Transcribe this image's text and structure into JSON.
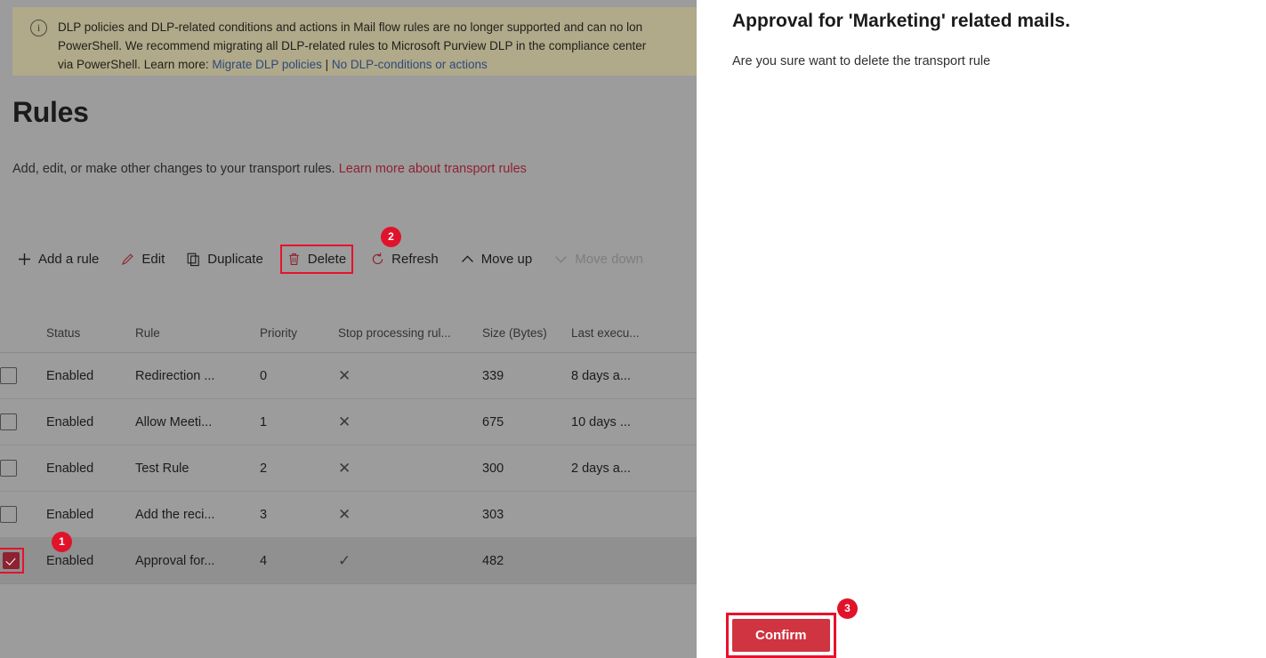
{
  "banner": {
    "icon": "info-icon",
    "line1": "DLP policies and DLP-related conditions and actions in Mail flow rules are no longer supported and can no lon",
    "line2": "PowerShell. We recommend migrating all DLP-related rules to Microsoft Purview DLP in the compliance center",
    "line3_prefix": "via PowerShell. Learn more: ",
    "link1": "Migrate DLP policies",
    "separator": " | ",
    "link2": "No DLP-conditions or actions",
    "background": "#b0a98a"
  },
  "page": {
    "title": "Rules",
    "subtitle_text": "Add, edit, or make other changes to your transport rules. ",
    "subtitle_link": "Learn more about transport rules"
  },
  "command_bar": {
    "items": [
      {
        "label": "Add a rule",
        "icon": "plus-icon",
        "disabled": false,
        "highlighted": false
      },
      {
        "label": "Edit",
        "icon": "pencil-icon",
        "disabled": false,
        "highlighted": false
      },
      {
        "label": "Duplicate",
        "icon": "copy-icon",
        "disabled": false,
        "highlighted": false
      },
      {
        "label": "Delete",
        "icon": "trash-icon",
        "disabled": false,
        "highlighted": true
      },
      {
        "label": "Refresh",
        "icon": "refresh-icon",
        "disabled": false,
        "highlighted": false
      },
      {
        "label": "Move up",
        "icon": "chevron-up-icon",
        "disabled": false,
        "highlighted": false
      },
      {
        "label": "Move down",
        "icon": "chevron-down-icon",
        "disabled": true,
        "highlighted": false
      }
    ]
  },
  "table": {
    "columns": [
      "Status",
      "Rule",
      "Priority",
      "Stop processing rul...",
      "Size (Bytes)",
      "Last execu..."
    ],
    "rows": [
      {
        "checked": false,
        "status": "Enabled",
        "rule": "Redirection ...",
        "priority": "0",
        "stop": "✕",
        "size": "339",
        "last": "8 days a...",
        "selected": false
      },
      {
        "checked": false,
        "status": "Enabled",
        "rule": "Allow Meeti...",
        "priority": "1",
        "stop": "✕",
        "size": "675",
        "last": "10 days ...",
        "selected": false
      },
      {
        "checked": false,
        "status": "Enabled",
        "rule": "Test Rule",
        "priority": "2",
        "stop": "✕",
        "size": "300",
        "last": "2 days a...",
        "selected": false
      },
      {
        "checked": false,
        "status": "Enabled",
        "rule": "Add the reci...",
        "priority": "3",
        "stop": "✕",
        "size": "303",
        "last": "",
        "selected": false
      },
      {
        "checked": true,
        "status": "Enabled",
        "rule": "Approval for...",
        "priority": "4",
        "stop": "✓",
        "size": "482",
        "last": "",
        "selected": true
      }
    ]
  },
  "panel": {
    "title": "Approval for 'Marketing' related mails.",
    "description": "Are you sure want to delete the transport rule",
    "confirm_label": "Confirm"
  },
  "badges": {
    "one": "1",
    "two": "2",
    "three": "3"
  },
  "colors": {
    "accent_red": "#e8112d",
    "button_red": "#cf3440",
    "link_red": "#8e2230",
    "overlay_gray": "#9c9c9c"
  }
}
